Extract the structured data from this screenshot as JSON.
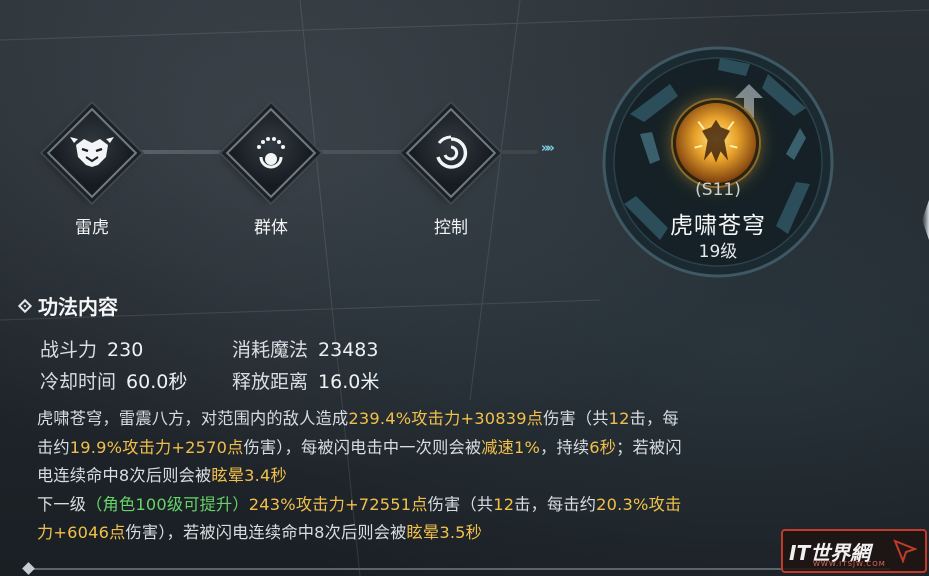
{
  "track": {
    "nodes": [
      {
        "label": "雷虎",
        "icon": "tiger-icon"
      },
      {
        "label": "群体",
        "icon": "group-icon"
      },
      {
        "label": "控制",
        "icon": "control-swirl-icon"
      }
    ],
    "arrows": "»»"
  },
  "skill": {
    "code": "(S11)",
    "name": "虎啸苍穹",
    "level": "19级",
    "icon": "tiger-roar-skill-icon",
    "upgrade_icon": "upgrade-arrow-icon"
  },
  "section": {
    "title": "功法内容"
  },
  "stats": [
    {
      "key": "战斗力",
      "value": "230"
    },
    {
      "key": "消耗魔法",
      "value": "23483"
    },
    {
      "key": "冷却时间",
      "value": "60.0秒"
    },
    {
      "key": "释放距离",
      "value": "16.0米"
    }
  ],
  "description": {
    "line1": [
      {
        "t": "虎啸苍穹，雷震八方，对范围内的敌人造成",
        "c": "n"
      },
      {
        "t": "239.4%攻击力+30839点",
        "c": "y"
      },
      {
        "t": "伤害（共",
        "c": "n"
      },
      {
        "t": "12",
        "c": "y"
      },
      {
        "t": "击，每",
        "c": "n"
      }
    ],
    "line2": [
      {
        "t": "击约",
        "c": "n"
      },
      {
        "t": "19.9%攻击力+2570点",
        "c": "y"
      },
      {
        "t": "伤害），每被闪电击中一次则会被",
        "c": "n"
      },
      {
        "t": "减速1%",
        "c": "y"
      },
      {
        "t": "，持续",
        "c": "n"
      },
      {
        "t": "6秒",
        "c": "y"
      },
      {
        "t": "；若被闪",
        "c": "n"
      }
    ],
    "line3": [
      {
        "t": "电连续命中8次后则会被",
        "c": "n"
      },
      {
        "t": "眩晕3.4秒",
        "c": "y"
      }
    ],
    "line4": [
      {
        "t": "下一级",
        "c": "n"
      },
      {
        "t": "（角色100级可提升）",
        "c": "g"
      },
      {
        "t": "243%攻击力+72551点",
        "c": "y"
      },
      {
        "t": "伤害（共",
        "c": "n"
      },
      {
        "t": "12",
        "c": "y"
      },
      {
        "t": "击，每击约",
        "c": "n"
      },
      {
        "t": "20.3%攻击",
        "c": "y"
      }
    ],
    "line5": [
      {
        "t": "力+6046点",
        "c": "y"
      },
      {
        "t": "伤害），若被闪电连续命中8次后则会被",
        "c": "n"
      },
      {
        "t": "眩晕3.5秒",
        "c": "y"
      }
    ]
  },
  "watermark": {
    "text": "IT世界網",
    "sub": "WWW.ITSJW.COM"
  },
  "colors": {
    "highlight": "#f2c04a",
    "green": "#67d36a",
    "accent_cyan": "#7fd3e8"
  }
}
